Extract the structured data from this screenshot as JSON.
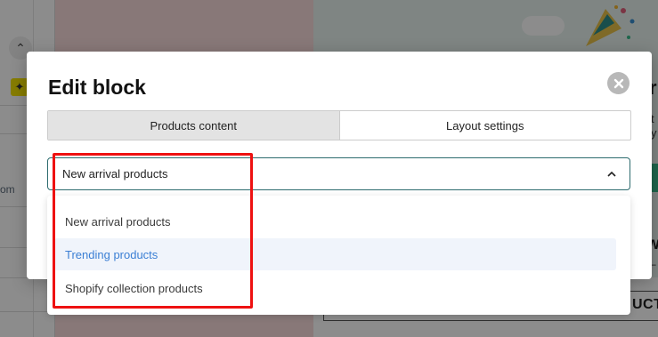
{
  "background": {
    "side_text": "om",
    "right_letter_top": "r",
    "right_text_1": "t",
    "right_text_2": "y",
    "right_letter_mid": "w",
    "right_text_3": "–",
    "cta_text": "UCT",
    "collapse_icon": "chevron-up-icon",
    "bulb_icon": "lightbulb-icon"
  },
  "modal": {
    "title": "Edit block",
    "close_icon": "close-icon",
    "tabs": [
      {
        "label": "Products content",
        "active": true
      },
      {
        "label": "Layout settings",
        "active": false
      }
    ]
  },
  "dropdown": {
    "selected": "New arrival products",
    "chevron_icon": "chevron-up-icon",
    "options": [
      {
        "label": "New arrival products",
        "highlighted": false
      },
      {
        "label": "Trending products",
        "highlighted": true
      },
      {
        "label": "Shopify collection products",
        "highlighted": false
      }
    ]
  },
  "colors": {
    "overlay": "#000000",
    "accent_border": "#2d6b6e",
    "highlight_text": "#3b7fd4",
    "annotation": "#ee1111"
  }
}
